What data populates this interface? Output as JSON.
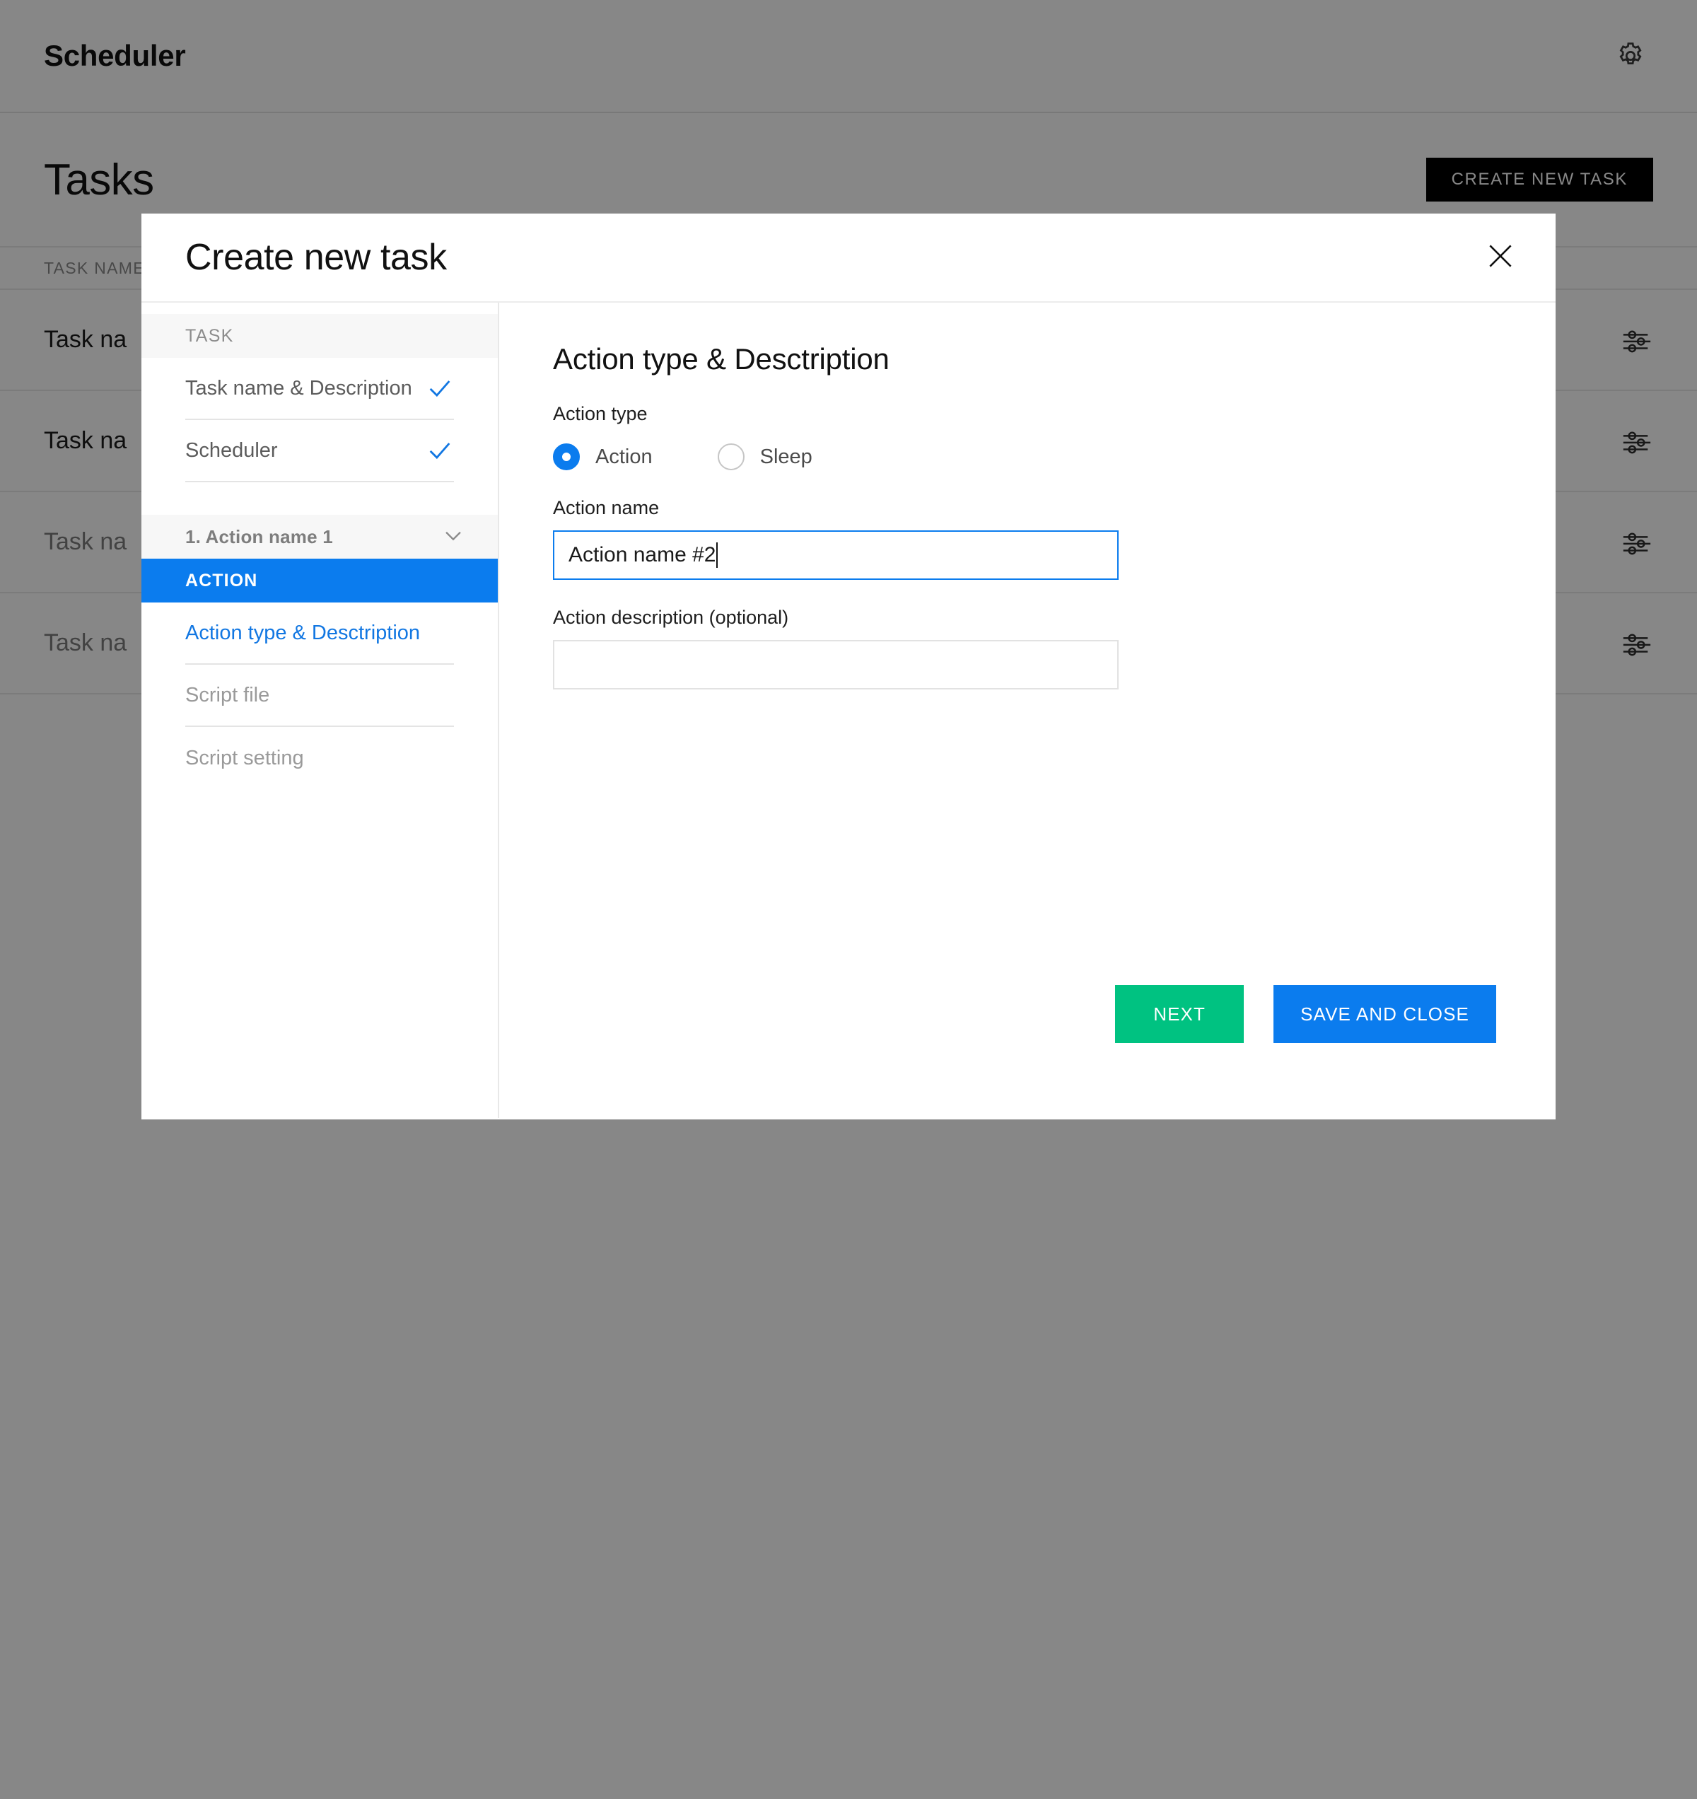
{
  "app": {
    "title": "Scheduler",
    "settings_icon": "gear-icon"
  },
  "page": {
    "title": "Tasks",
    "create_button": "CREATE NEW TASK"
  },
  "table": {
    "columns": [
      "TASK NAME"
    ],
    "rows": [
      {
        "name": "Task na",
        "row_icon": "sliders-icon"
      },
      {
        "name": "Task na",
        "row_icon": "sliders-icon"
      },
      {
        "name": "Task na",
        "row_icon": "sliders-icon"
      },
      {
        "name": "Task na",
        "row_icon": "sliders-icon"
      }
    ]
  },
  "modal": {
    "title": "Create new task",
    "close_icon": "close-icon",
    "sidebar": {
      "task_group_label": "TASK",
      "task_items": [
        {
          "label": "Task name & Description",
          "state": "completed"
        },
        {
          "label": "Scheduler",
          "state": "completed"
        }
      ],
      "action_group_label": "1. Action name 1",
      "action_group_icon": "chevron-down-icon",
      "action_section_label": "ACTION",
      "action_items": [
        {
          "label": "Action type & Desctription",
          "state": "current"
        },
        {
          "label": "Script file",
          "state": "pending"
        },
        {
          "label": "Script setting",
          "state": "pending"
        }
      ]
    },
    "main": {
      "section_title": "Action type & Desctription",
      "action_type_label": "Action type",
      "radio_options": [
        {
          "label": "Action",
          "selected": true
        },
        {
          "label": "Sleep",
          "selected": false
        }
      ],
      "action_name_label": "Action name",
      "action_name_value": "Action name #2",
      "action_description_label": "Action description (optional)",
      "action_description_value": ""
    },
    "buttons": {
      "next": "NEXT",
      "save_and_close": "SAVE AND CLOSE"
    }
  },
  "colors": {
    "accent_blue": "#0b7cee",
    "success_green": "#00c281",
    "dark_button": "#000000"
  }
}
